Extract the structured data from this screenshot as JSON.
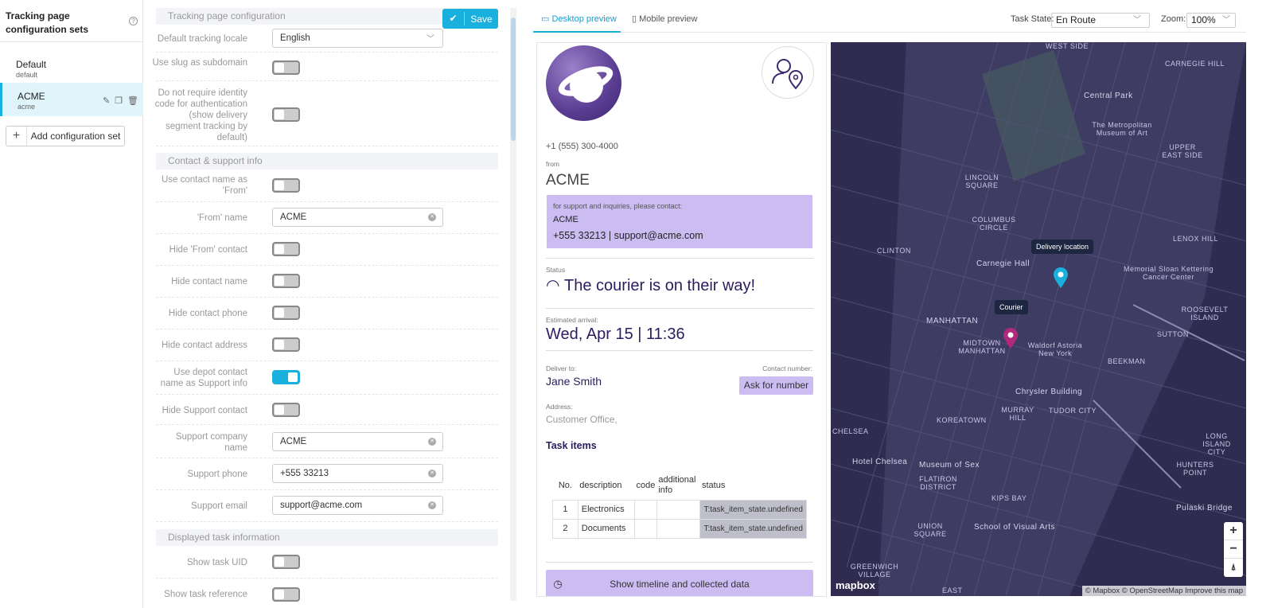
{
  "sidebar": {
    "title": "Tracking page configuration sets",
    "help_icon": "question-icon",
    "items": [
      {
        "name": "Default",
        "slug": "default"
      },
      {
        "name": "ACME",
        "slug": "acme"
      }
    ],
    "add_label": "Add configuration set"
  },
  "config": {
    "save_label": "Save",
    "sections": [
      "Tracking page configuration",
      "Contact & support info",
      "Displayed task information"
    ],
    "fields": {
      "default_locale": {
        "label": "Default tracking locale",
        "value": "English"
      },
      "use_slug": {
        "label": "Use slug as subdomain",
        "on": false
      },
      "no_identity": {
        "label": "Do not require identity code for authentication (show delivery segment tracking by default)",
        "on": false
      },
      "contact_as_from": {
        "label": "Use contact name as 'From'",
        "on": false
      },
      "from_name": {
        "label": "'From' name",
        "value": "ACME"
      },
      "hide_from": {
        "label": "Hide 'From' contact",
        "on": false
      },
      "hide_name": {
        "label": "Hide contact name",
        "on": false
      },
      "hide_phone": {
        "label": "Hide contact phone",
        "on": false
      },
      "hide_address": {
        "label": "Hide contact address",
        "on": false
      },
      "depot_support": {
        "label": "Use depot contact name as Support info",
        "on": true
      },
      "hide_support": {
        "label": "Hide Support contact",
        "on": false
      },
      "support_company": {
        "label": "Support company name",
        "value": "ACME"
      },
      "support_phone": {
        "label": "Support phone",
        "value": "+555 33213"
      },
      "support_email": {
        "label": "Support email",
        "value": "support@acme.com"
      },
      "show_uid": {
        "label": "Show task UID",
        "on": false
      },
      "show_ref": {
        "label": "Show task reference",
        "on": false
      }
    }
  },
  "preview": {
    "tabs": [
      "Desktop preview",
      "Mobile preview"
    ],
    "task_state_label": "Task State:",
    "task_state": "En Route",
    "zoom_label": "Zoom:",
    "zoom": "100%",
    "phone": "+1 (555) 300-4000",
    "from_label": "from",
    "from_name": "ACME",
    "support_intro": "for support and inquiries, please contact:",
    "support_name": "ACME",
    "support_contact": "+555 33213 | support@acme.com",
    "status_label": "Status",
    "status_text": "The courier is on their way!",
    "eta_label": "Estimated arrival:",
    "eta": "Wed, Apr 15 | 11:36",
    "deliver_label": "Deliver to:",
    "deliver_name": "Jane Smith",
    "contact_number_label": "Contact number:",
    "ask_label": "Ask for number",
    "address_label": "Address:",
    "address": "Customer Office,",
    "items_title": "Task items",
    "items_headers": [
      "No.",
      "description",
      "code",
      "additional info",
      "status"
    ],
    "items": [
      {
        "no": "1",
        "description": "Electronics",
        "code": "",
        "info": "",
        "status": "T:task_item_state.undefined"
      },
      {
        "no": "2",
        "description": "Documents",
        "code": "",
        "info": "",
        "status": "T:task_item_state.undefined"
      }
    ],
    "timeline_label": "Show timeline and collected data"
  },
  "map": {
    "labels": [
      "WEST SIDE",
      "CARNEGIE HILL",
      "Central Park",
      "The Metropolitan Museum of Art",
      "UPPER EAST SIDE",
      "LINCOLN SQUARE",
      "COLUMBUS CIRCLE",
      "LENOX HILL",
      "CLINTON",
      "Carnegie Hall",
      "Memorial Sloan Kettering Cancer Center",
      "ROOSEVELT ISLAND",
      "MANHATTAN",
      "MIDTOWN MANHATTAN",
      "Waldorf Astoria New York",
      "SUTTON",
      "BEEKMAN",
      "Chrysler Building",
      "MURRAY HILL",
      "TUDOR CITY",
      "KOREATOWN",
      "LONG ISLAND CITY",
      "Hotel Chelsea",
      "Museum of Sex",
      "FLATIRON DISTRICT",
      "HUNTERS POINT",
      "KIPS BAY",
      "Pulaski Bridge",
      "UNION SQUARE",
      "School of Visual Arts",
      "GREENWICH VILLAGE",
      "EAST",
      "CHELSEA"
    ],
    "delivery_tip": "Delivery location",
    "courier_tip": "Courier",
    "zoom_in": "+",
    "zoom_out": "−",
    "attribution": "© Mapbox © OpenStreetMap Improve this map",
    "brand": "mapbox"
  }
}
